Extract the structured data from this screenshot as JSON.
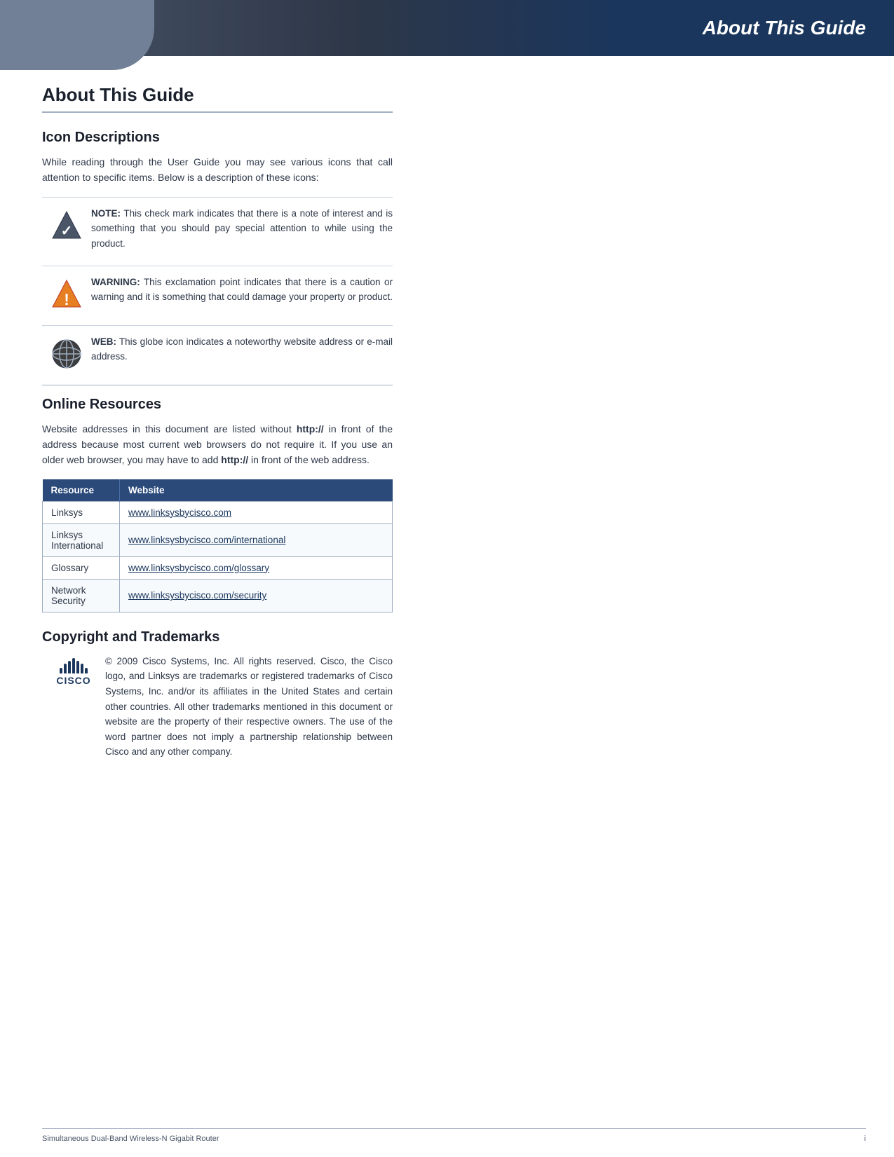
{
  "header": {
    "title": "About This Guide"
  },
  "page": {
    "title": "About This Guide",
    "sections": {
      "icon_descriptions": {
        "title": "Icon Descriptions",
        "intro": "While reading through the User Guide you may see various icons that call attention to specific items. Below is a description of these icons:",
        "icons": [
          {
            "type": "note",
            "label": "NOTE:",
            "text": "This check mark indicates that there is a note of interest and is something that you should pay special attention to while using the product."
          },
          {
            "type": "warning",
            "label": "WARNING:",
            "text": "This exclamation point indicates that there is a caution or warning and it is something that could damage your property or product."
          },
          {
            "type": "web",
            "label": "WEB:",
            "text": "This globe icon indicates a noteworthy website address or e-mail address."
          }
        ]
      },
      "online_resources": {
        "title": "Online Resources",
        "intro_part1": "Website addresses in this document are listed without ",
        "http": "http://",
        "intro_part2": " in front of the address because most current web browsers do not require it. If you use an older web browser, you may have to add ",
        "http2": "http://",
        "intro_part3": " in front of the web address.",
        "table": {
          "headers": [
            "Resource",
            "Website"
          ],
          "rows": [
            [
              "Linksys",
              "www.linksysbycisco.com"
            ],
            [
              "Linksys International",
              "www.linksysbycisco.com/international"
            ],
            [
              "Glossary",
              "www.linksysbycisco.com/glossary"
            ],
            [
              "Network Security",
              "www.linksysbycisco.com/security"
            ]
          ]
        }
      },
      "copyright": {
        "title": "Copyright and Trademarks",
        "text": "© 2009 Cisco Systems, Inc. All rights reserved. Cisco, the Cisco logo, and Linksys are trademarks or registered trademarks of Cisco Systems, Inc. and/or its affiliates in the United States and certain other countries. All other trademarks mentioned in this document or website are the property of their respective owners. The use of the word partner does not imply a partnership relationship between Cisco and any other company."
      }
    },
    "footer": {
      "left": "Simultaneous Dual-Band Wireless-N Gigabit Router",
      "right": "i"
    }
  }
}
